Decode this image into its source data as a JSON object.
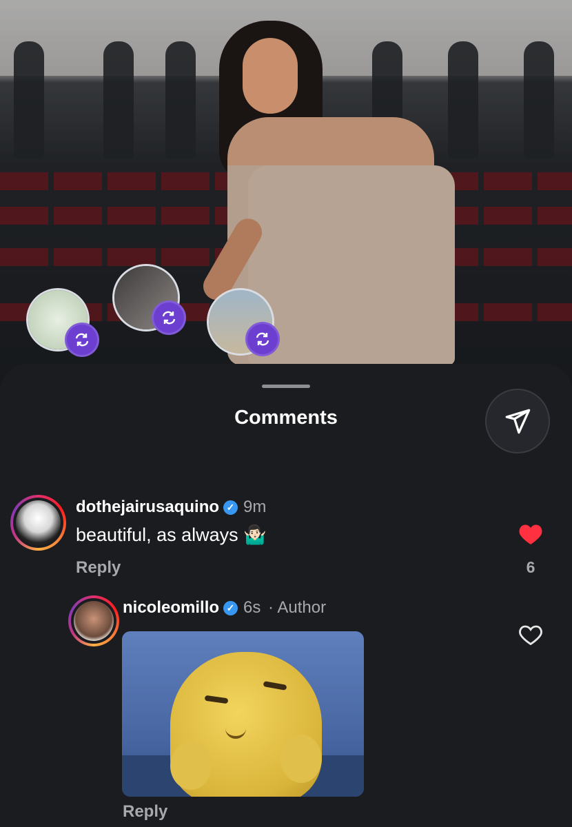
{
  "sheet": {
    "title": "Comments"
  },
  "comments": [
    {
      "username": "dothejairusaquino",
      "time": "9m",
      "text": "beautiful, as always 🤷🏻‍♂️",
      "reply_label": "Reply",
      "likes": "6",
      "liked": true
    },
    {
      "username": "nicoleomillo",
      "time": "6s",
      "meta_suffix": "· Author",
      "reply_label": "Reply",
      "liked": false,
      "has_gif": true
    }
  ],
  "colors": {
    "background": "#1b1c20",
    "like_red": "#ff3040",
    "verified_blue": "#3897f0",
    "repost_purple": "#6c3fd1"
  },
  "icons": [
    "repost-icon",
    "share-send-icon",
    "heart-icon",
    "verified-badge-icon"
  ]
}
